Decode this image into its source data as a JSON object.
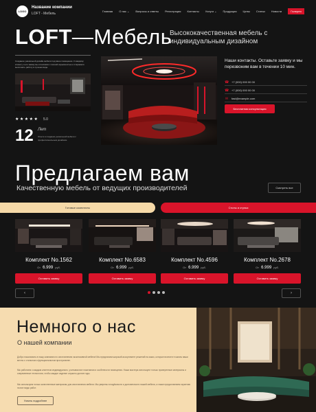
{
  "header": {
    "logo_text": "LOGO",
    "company_name": "Название компании",
    "company_sub": "LOFT - Мебель",
    "nav": [
      "Главная",
      "О нас",
      "Вопросы и ответы",
      "Регистрация",
      "Контакты",
      "Услуги",
      "Продукция",
      "Цены",
      "Статьи",
      "Новости"
    ],
    "nav_active": "Галерея",
    "nav_arrows": "⌄"
  },
  "hero": {
    "title_bold": "LOFT",
    "title_dash": "—",
    "title_thin": "Мебель",
    "description": "Высококачественная мебель с индивидуальным дизайном",
    "small_text": "Создание уникальной дизайн-мебели под ваше помещение. К каждому клиенту и его заказу мы относимся с полной серьёзностью и стараемся выполнить работу в лучшем виде.",
    "stars": "★★★★★",
    "rating": "5.0",
    "years_number": "12",
    "years_label": "Лет",
    "years_desc": "Опыта в создании уникальной мебели с профессиональным дизайном",
    "contact_title": "Наши контакты. Оставьте заявку и мы перезвоним вам в течении 10 мин.",
    "phone1": "+7 (000) 000 00 00",
    "phone2": "+7 (000) 000 00 00",
    "email": "fast@example.com",
    "consult_button": "Бесплатная консультация"
  },
  "offer": {
    "title": "Предлагаем вам",
    "subtitle": "Качественную мебель от ведущих производителей",
    "watch_button": "Смотреть все",
    "tab_left": "Готовые комплекты",
    "tab_right": "Столы и стулья",
    "cards": [
      {
        "name": "Комплект No.1562",
        "price_from": "От",
        "price": "6.999",
        "currency": "руб.",
        "button": "Оставить заявку"
      },
      {
        "name": "Комплект No.6583",
        "price_from": "От",
        "price": "6.999",
        "currency": "руб.",
        "button": "Оставить заявку"
      },
      {
        "name": "Комплект No.4596",
        "price_from": "От",
        "price": "6.999",
        "currency": "руб.",
        "button": "Оставить заявку"
      },
      {
        "name": "Комплект No.2678",
        "price_from": "От",
        "price": "6.999",
        "currency": "руб.",
        "button": "Оставить заявку"
      }
    ],
    "prev": "‹",
    "next": "›"
  },
  "about": {
    "title": "Немного о нас",
    "subtitle": "О нашей компании",
    "p1": "Добро пожаловать в нашу компанию по изготовлению эксклюзивной мебели! Мы предлагаем широкий ассортимент решений на заказ, которые воплотят в жизнь ваши мечты о стильном и функциональном пространстве.",
    "p2": "Мы работаем с каждым клиентом индивидуально, учитывая все пожелания и особенности помещения. Наши мастера используют только проверенные материалы и современные технологии, чтобы каждое изделие служило долгие годы.",
    "p3": "Мы используем только качественные материалы для изготовления мебели. Мы уверены в надёжности и долговечности нашей мебели, а также предоставляем гарантию на все виды работ.",
    "more_button": "Узнать подробнее"
  },
  "colors": {
    "accent": "#d9142a",
    "dark": "#141414",
    "beige": "#f6dcb0"
  }
}
